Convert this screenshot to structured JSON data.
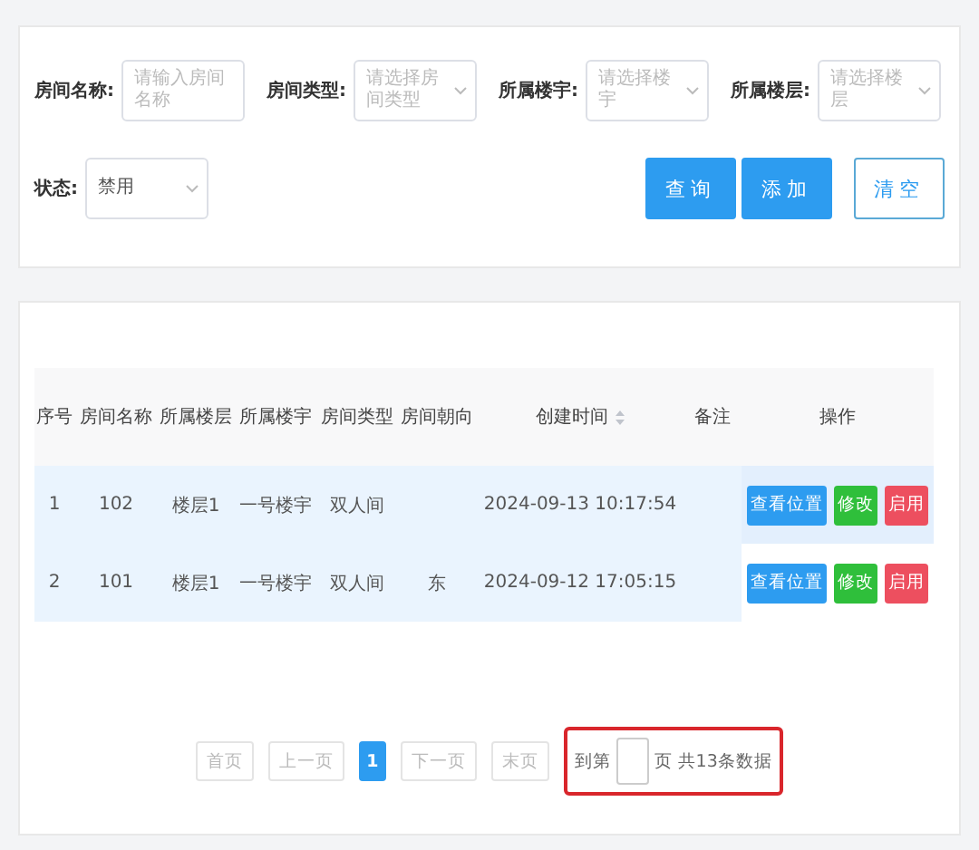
{
  "filters": [
    {
      "kind": "input",
      "label": "房间名称:",
      "placeholder": "请输入房间名称"
    },
    {
      "kind": "select",
      "label": "房间类型:",
      "placeholder": "请选择房间类型"
    },
    {
      "kind": "select",
      "label": "所属楼宇:",
      "placeholder": "请选择楼宇"
    },
    {
      "kind": "select",
      "label": "所属楼层:",
      "placeholder": "请选择楼层"
    },
    {
      "kind": "select",
      "label": "状态:",
      "value": "禁用"
    }
  ],
  "actions": [
    {
      "label": "查询",
      "kind": "primary"
    },
    {
      "label": "添加",
      "kind": "primary"
    },
    {
      "label": "清空",
      "kind": "outline"
    }
  ],
  "table": {
    "columns": [
      {
        "label": "序号"
      },
      {
        "label": "房间名称"
      },
      {
        "label": "所属楼层"
      },
      {
        "label": "所属楼宇"
      },
      {
        "label": "房间类型"
      },
      {
        "label": "房间朝向"
      },
      {
        "label": "创建时间",
        "sortable": true
      },
      {
        "label": "备注"
      },
      {
        "label": "操作"
      }
    ],
    "rows": [
      {
        "cells": [
          "1",
          "102",
          "楼层1",
          "一号楼宇",
          "双人间",
          "",
          "2024-09-13 10:17:54",
          ""
        ],
        "hovered": true,
        "ops": [
          {
            "label": "查看位置",
            "kind": "view"
          },
          {
            "label": "修改",
            "kind": "edit"
          },
          {
            "label": "启用",
            "kind": "enable"
          }
        ]
      },
      {
        "cells": [
          "2",
          "101",
          "楼层1",
          "一号楼宇",
          "双人间",
          "东",
          "2024-09-12 17:05:15",
          ""
        ],
        "hovered": false,
        "ops": [
          {
            "label": "查看位置",
            "kind": "view"
          },
          {
            "label": "修改",
            "kind": "edit"
          },
          {
            "label": "启用",
            "kind": "enable"
          }
        ]
      }
    ]
  },
  "pagination": {
    "pages": [
      {
        "label": "首页",
        "kind": "nav",
        "selected": false
      },
      {
        "label": "上一页",
        "kind": "nav",
        "selected": false
      },
      {
        "label": "1",
        "kind": "page",
        "selected": true
      },
      {
        "label": "下一页",
        "kind": "nav",
        "selected": false
      },
      {
        "label": "末页",
        "kind": "nav",
        "selected": false
      }
    ],
    "jump": {
      "before": "到第",
      "after": "页 共13条数据",
      "highlighted": true
    }
  }
}
